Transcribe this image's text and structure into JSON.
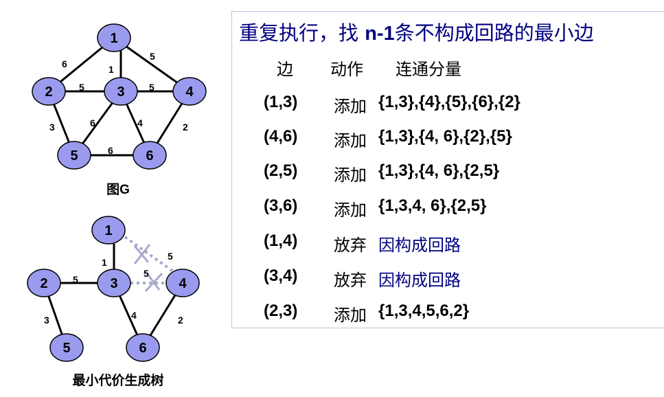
{
  "graph_g": {
    "caption": "图G",
    "nodes": [
      "1",
      "2",
      "3",
      "4",
      "5",
      "6"
    ],
    "edges": [
      {
        "u": "1",
        "v": "2",
        "w": "6"
      },
      {
        "u": "1",
        "v": "3",
        "w": "1"
      },
      {
        "u": "1",
        "v": "4",
        "w": "5"
      },
      {
        "u": "2",
        "v": "3",
        "w": "5"
      },
      {
        "u": "3",
        "v": "4",
        "w": "5"
      },
      {
        "u": "2",
        "v": "5",
        "w": "3"
      },
      {
        "u": "3",
        "v": "5",
        "w": "6"
      },
      {
        "u": "3",
        "v": "6",
        "w": "4"
      },
      {
        "u": "4",
        "v": "6",
        "w": "2"
      },
      {
        "u": "5",
        "v": "6",
        "w": "6"
      }
    ]
  },
  "mst": {
    "caption": "最小代价生成树",
    "nodes": [
      "1",
      "2",
      "3",
      "4",
      "5",
      "6"
    ],
    "kept_edges": [
      {
        "u": "1",
        "v": "3",
        "w": "1"
      },
      {
        "u": "2",
        "v": "3",
        "w": "5"
      },
      {
        "u": "2",
        "v": "5",
        "w": "3"
      },
      {
        "u": "3",
        "v": "6",
        "w": "4"
      },
      {
        "u": "4",
        "v": "6",
        "w": "2"
      }
    ],
    "rejected_edges": [
      {
        "u": "1",
        "v": "4",
        "w": "5"
      },
      {
        "u": "3",
        "v": "4",
        "w": "5"
      }
    ]
  },
  "panel": {
    "title_prefix": "重复执行，找 ",
    "title_bold": "n-1",
    "title_suffix": "条不构成回路的最小边",
    "headers": {
      "edge": "边",
      "action": "动作",
      "components": "连通分量"
    },
    "steps": [
      {
        "edge": "(1,3)",
        "action": "添加",
        "components": "{1,3},{4},{5},{6},{2}"
      },
      {
        "edge": "(4,6)",
        "action": "添加",
        "components": "{1,3},{4, 6},{2},{5}"
      },
      {
        "edge": "(2,5)",
        "action": "添加",
        "components": "{1,3},{4, 6},{2,5}"
      },
      {
        "edge": "(3,6)",
        "action": "添加",
        "components": "{1,3,4, 6},{2,5}"
      },
      {
        "edge": "(1,4)",
        "action": "放弃",
        "components": "因构成回路"
      },
      {
        "edge": "(3,4)",
        "action": "放弃",
        "components": "因构成回路"
      },
      {
        "edge": "(2,3)",
        "action": "添加",
        "components": "{1,3,4,5,6,2}"
      }
    ]
  },
  "colors": {
    "node_fill": "#9a9aee",
    "node_stroke": "#000000",
    "title_text": "#000080",
    "reason_text": "#000080",
    "rejected_edge": "#a8a8cc"
  }
}
